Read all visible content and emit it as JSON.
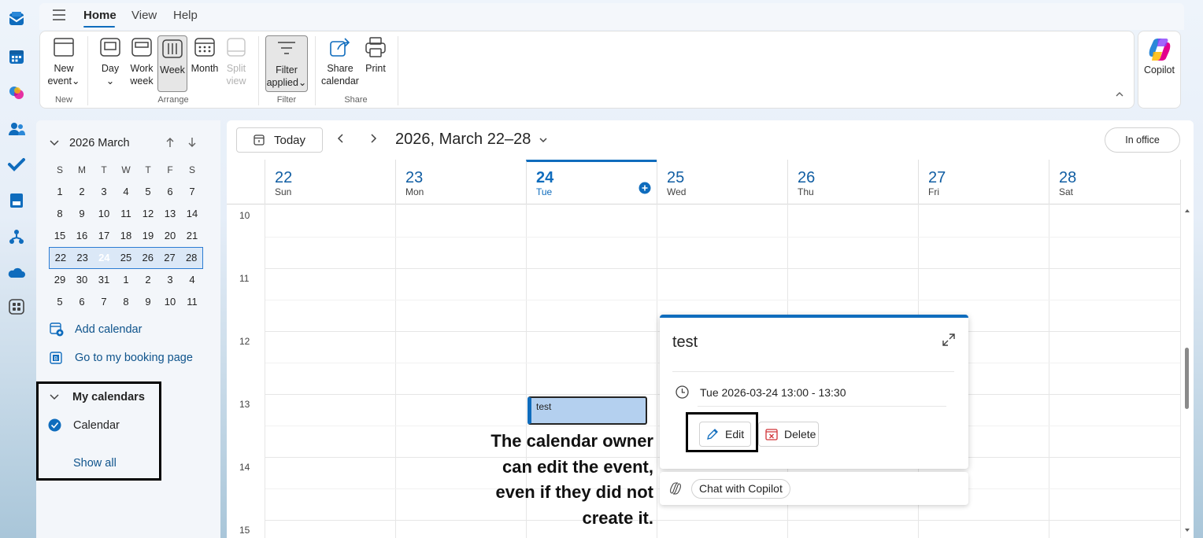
{
  "ribbon_tabs": [
    "Home",
    "View",
    "Help"
  ],
  "ribbon": {
    "new_event": {
      "line1": "New",
      "line2": "event"
    },
    "day": "Day",
    "work_week": {
      "line1": "Work",
      "line2": "week"
    },
    "week": "Week",
    "month": "Month",
    "split_view": {
      "line1": "Split",
      "line2": "view"
    },
    "filter_applied": {
      "line1": "Filter",
      "line2": "applied"
    },
    "share_calendar": {
      "line1": "Share",
      "line2": "calendar"
    },
    "print": "Print",
    "groups": {
      "new": "New",
      "arrange": "Arrange",
      "filter": "Filter",
      "share": "Share"
    },
    "copilot": "Copilot"
  },
  "mini_calendar": {
    "title": "2026 March",
    "dow": [
      "S",
      "M",
      "T",
      "W",
      "T",
      "F",
      "S"
    ],
    "weeks": [
      [
        "1",
        "2",
        "3",
        "4",
        "5",
        "6",
        "7"
      ],
      [
        "8",
        "9",
        "10",
        "11",
        "12",
        "13",
        "14"
      ],
      [
        "15",
        "16",
        "17",
        "18",
        "19",
        "20",
        "21"
      ],
      [
        "22",
        "23",
        "24",
        "25",
        "26",
        "27",
        "28"
      ],
      [
        "29",
        "30",
        "31",
        "1",
        "2",
        "3",
        "4"
      ],
      [
        "5",
        "6",
        "7",
        "8",
        "9",
        "10",
        "11"
      ]
    ]
  },
  "sidebar": {
    "add_calendar": "Add calendar",
    "booking_page": "Go to my booking page",
    "my_calendars": "My calendars",
    "calendar": "Calendar",
    "show_all": "Show all"
  },
  "toolbar": {
    "today": "Today",
    "range": "2026, March 22–28",
    "in_office": "In office"
  },
  "days": [
    {
      "num": "22",
      "name": "Sun"
    },
    {
      "num": "23",
      "name": "Mon"
    },
    {
      "num": "24",
      "name": "Tue"
    },
    {
      "num": "25",
      "name": "Wed"
    },
    {
      "num": "26",
      "name": "Thu"
    },
    {
      "num": "27",
      "name": "Fri"
    },
    {
      "num": "28",
      "name": "Sat"
    }
  ],
  "hours": [
    "10",
    "11",
    "12",
    "13",
    "14",
    "15"
  ],
  "event": {
    "title": "test"
  },
  "annotation": {
    "line1": "The calendar owner",
    "line2": "can edit the event,",
    "line3": "even if they did not",
    "line4": "create it."
  },
  "popup": {
    "title": "test",
    "time": "Tue 2026-03-24 13:00 - 13:30",
    "edit": "Edit",
    "delete": "Delete"
  },
  "copilot_bar": {
    "chat": "Chat with Copilot"
  },
  "colors": {
    "accent": "#0f6cbd",
    "event_fill": "#b4d0ef",
    "delete_red": "#d13438"
  }
}
